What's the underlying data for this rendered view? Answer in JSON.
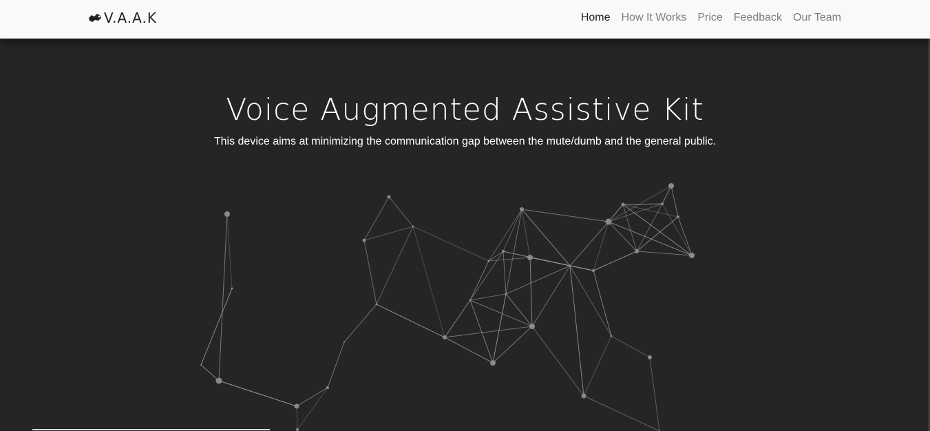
{
  "navbar": {
    "brand": "V.A.A.K",
    "brand_icon": "hand-gesture-icon",
    "links": [
      {
        "label": "Home",
        "active": true
      },
      {
        "label": "How It Works",
        "active": false
      },
      {
        "label": "Price",
        "active": false
      },
      {
        "label": "Feedback",
        "active": false
      },
      {
        "label": "Our Team",
        "active": false
      }
    ]
  },
  "hero": {
    "title": "Voice Augmented Assistive Kit",
    "subtitle": "This device aims at minimizing the communication gap between the mute/dumb and the general public."
  },
  "colors": {
    "navbar_bg": "#f8f9fa",
    "hero_bg": "#252525",
    "nav_active": "#222222",
    "nav_inactive": "#7d7d7d",
    "particle": "#8a8a8a"
  }
}
